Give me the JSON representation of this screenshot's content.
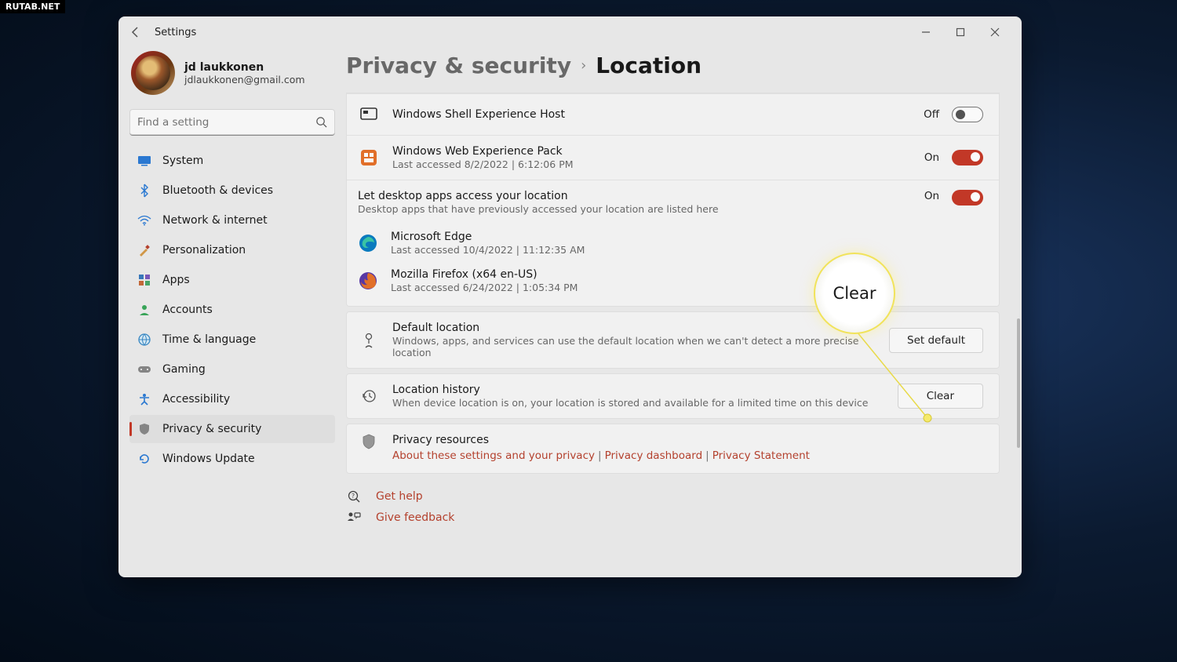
{
  "watermark": "RUTAB.NET",
  "window_title": "Settings",
  "profile": {
    "name": "jd laukkonen",
    "email": "jdlaukkonen@gmail.com"
  },
  "search_placeholder": "Find a setting",
  "nav": [
    {
      "label": "System"
    },
    {
      "label": "Bluetooth & devices"
    },
    {
      "label": "Network & internet"
    },
    {
      "label": "Personalization"
    },
    {
      "label": "Apps"
    },
    {
      "label": "Accounts"
    },
    {
      "label": "Time & language"
    },
    {
      "label": "Gaming"
    },
    {
      "label": "Accessibility"
    },
    {
      "label": "Privacy & security"
    },
    {
      "label": "Windows Update"
    }
  ],
  "breadcrumb": {
    "parent": "Privacy & security",
    "current": "Location"
  },
  "apps": {
    "shell": {
      "title": "Windows Shell Experience Host",
      "state": "Off"
    },
    "web": {
      "title": "Windows Web Experience Pack",
      "sub": "Last accessed 8/2/2022  |  6:12:06 PM",
      "state": "On"
    }
  },
  "desktop_access": {
    "title": "Let desktop apps access your location",
    "sub": "Desktop apps that have previously accessed your location are listed here",
    "state": "On",
    "list": [
      {
        "name": "Microsoft Edge",
        "sub": "Last accessed 10/4/2022  |  11:12:35 AM"
      },
      {
        "name": "Mozilla Firefox (x64 en-US)",
        "sub": "Last accessed 6/24/2022  |  1:05:34 PM"
      }
    ]
  },
  "default_location": {
    "title": "Default location",
    "sub": "Windows, apps, and services can use the default location when we can't detect a more precise location",
    "button": "Set default"
  },
  "location_history": {
    "title": "Location history",
    "sub": "When device location is on, your location is stored and available for a limited time on this device",
    "button": "Clear"
  },
  "privacy_resources": {
    "title": "Privacy resources",
    "links": [
      "About these settings and your privacy",
      "Privacy dashboard",
      "Privacy Statement"
    ]
  },
  "footer": {
    "help": "Get help",
    "feedback": "Give feedback"
  },
  "callout_text": "Clear"
}
